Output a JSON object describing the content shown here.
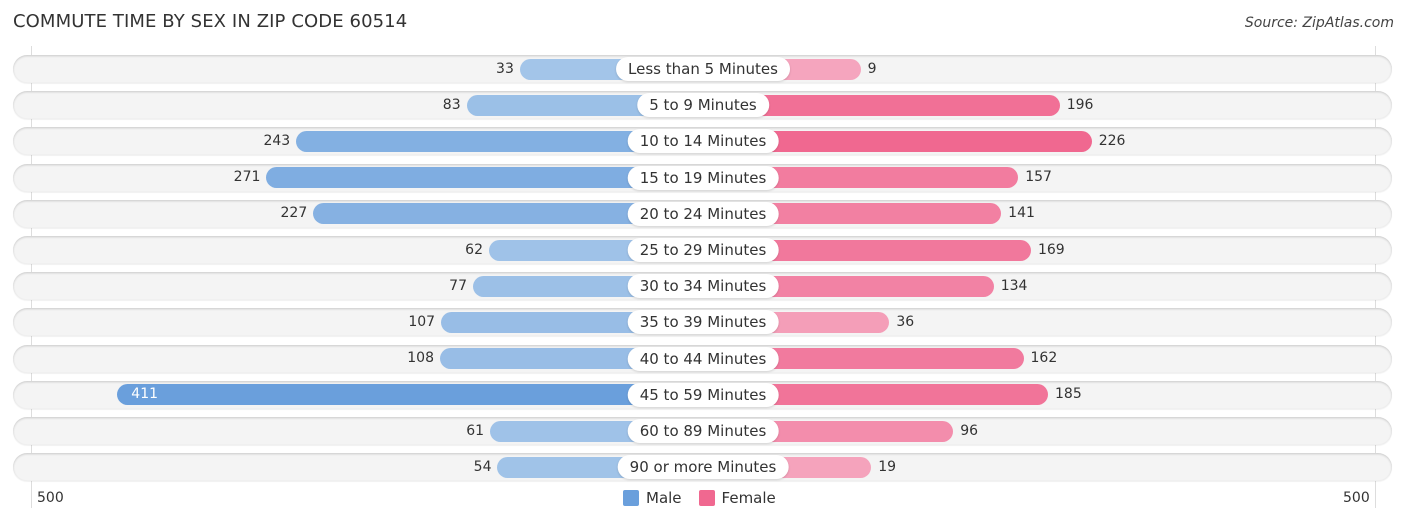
{
  "title": "COMMUTE TIME BY SEX IN ZIP CODE 60514",
  "source": "Source: ZipAtlas.com",
  "colors": {
    "male": "#6a9fdc",
    "female": "#f06890",
    "male_light": "#a8c8ea",
    "female_light": "#f5a8c0"
  },
  "chart_data": {
    "type": "bar",
    "orientation": "horizontal-diverging",
    "title": "COMMUTE TIME BY SEX IN ZIP CODE 60514",
    "categories": [
      "Less than 5 Minutes",
      "5 to 9 Minutes",
      "10 to 14 Minutes",
      "15 to 19 Minutes",
      "20 to 24 Minutes",
      "25 to 29 Minutes",
      "30 to 34 Minutes",
      "35 to 39 Minutes",
      "40 to 44 Minutes",
      "45 to 59 Minutes",
      "60 to 89 Minutes",
      "90 or more Minutes"
    ],
    "series": [
      {
        "name": "Male",
        "values": [
          33,
          83,
          243,
          271,
          227,
          62,
          77,
          107,
          108,
          411,
          61,
          54
        ]
      },
      {
        "name": "Female",
        "values": [
          9,
          196,
          226,
          157,
          141,
          169,
          134,
          36,
          162,
          185,
          96,
          19
        ]
      }
    ],
    "axis": {
      "left_label": "500",
      "right_label": "500",
      "max": 500
    },
    "legend": {
      "position": "bottom-center",
      "entries": [
        "Male",
        "Female"
      ]
    }
  }
}
